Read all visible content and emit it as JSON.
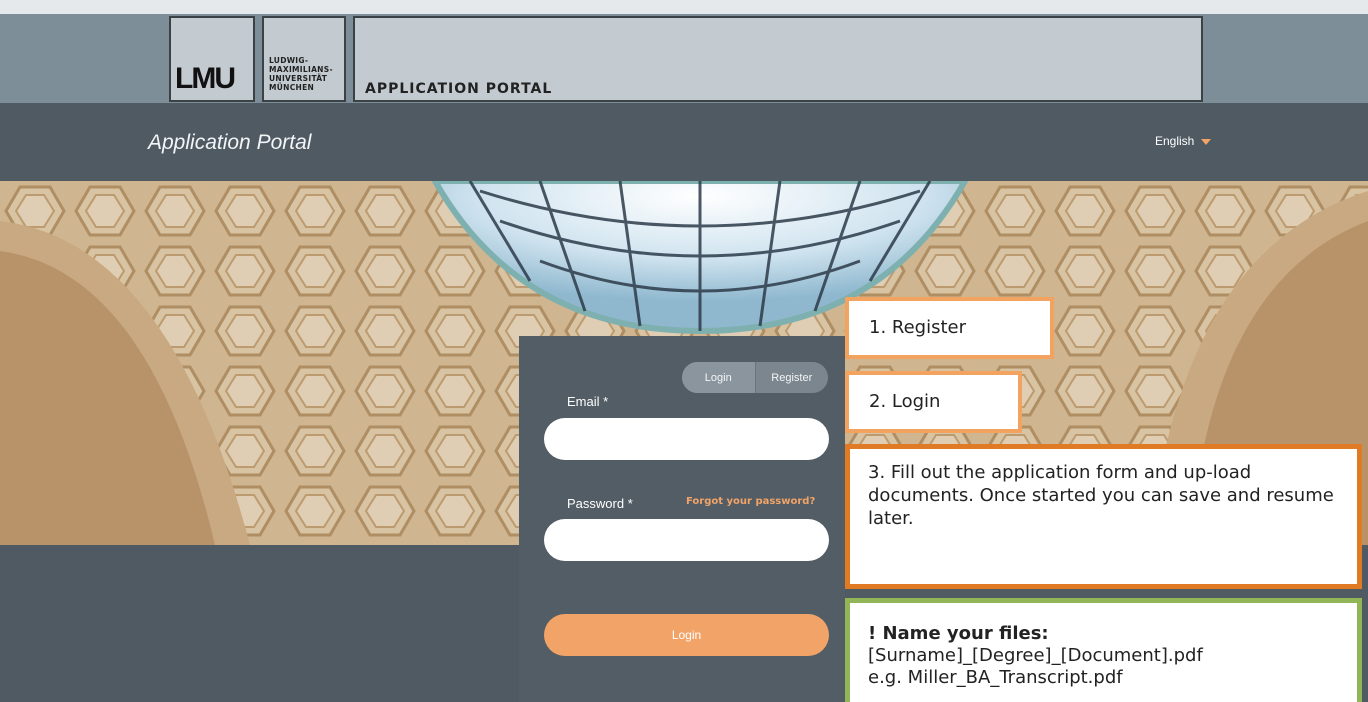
{
  "banner": {
    "logo_mark": "LMU",
    "university_lines": [
      "LUDWIG-",
      "MAXIMILIANS-",
      "UNIVERSITÄT",
      "MÜNCHEN"
    ],
    "portal_title": "APPLICATION PORTAL"
  },
  "nav": {
    "title": "Application Portal",
    "language": "English"
  },
  "login": {
    "tabs": {
      "login": "Login",
      "register": "Register"
    },
    "email_label": "Email *",
    "email_value": "",
    "password_label": "Password *",
    "password_value": "",
    "forgot_link": "Forgot your password?",
    "submit_label": "Login"
  },
  "callouts": {
    "step1": "1. Register",
    "step2": "2. Login",
    "step3": "3. Fill out the application form and up-load documents. Once started you can save and resume later.",
    "note_heading": "! Name your files:",
    "note_line1": "[Surname]_[Degree]_[Document].pdf",
    "note_line2": "e.g. Miller_BA_Transcript.pdf"
  },
  "colors": {
    "nav_bg": "#4f5a62",
    "accent_orange": "#f2a468",
    "callout_orange": "#e07a24",
    "callout_green": "#92b557"
  }
}
